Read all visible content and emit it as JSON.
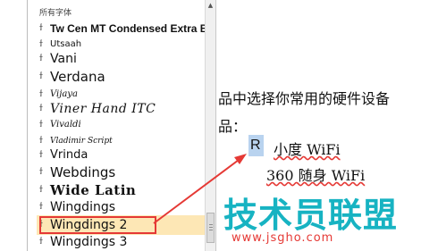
{
  "font_panel": {
    "section_header": "所有字体",
    "selected_font": "Wingdings 2",
    "fonts": [
      {
        "name": "Tw Cen MT Condensed Extra Bold"
      },
      {
        "name": "Utsaah"
      },
      {
        "name": "Vani"
      },
      {
        "name": "Verdana"
      },
      {
        "name": "Vijaya"
      },
      {
        "name": "Viner Hand ITC"
      },
      {
        "name": "Vivaldi"
      },
      {
        "name": "Vladimir Script"
      },
      {
        "name": "Vrinda"
      },
      {
        "name": "Webdings"
      },
      {
        "name": "Wide Latin"
      },
      {
        "name": "Wingdings"
      },
      {
        "name": "Wingdings 2"
      },
      {
        "name": "Wingdings 3"
      }
    ]
  },
  "document": {
    "line1": "品中选择你常用的硬件设备",
    "line2": "品：",
    "item1_letter": "R",
    "item1_text": "小度 WiFi",
    "item2_text": "360 随身 WiFi"
  },
  "watermark": {
    "brand": "技术员联盟",
    "url": "www.jsgho.com"
  },
  "colors": {
    "highlight_border": "#e53935",
    "hover_bg": "#fde7b5",
    "brand": "#17b3c2",
    "selection": "#b9d3ef"
  }
}
